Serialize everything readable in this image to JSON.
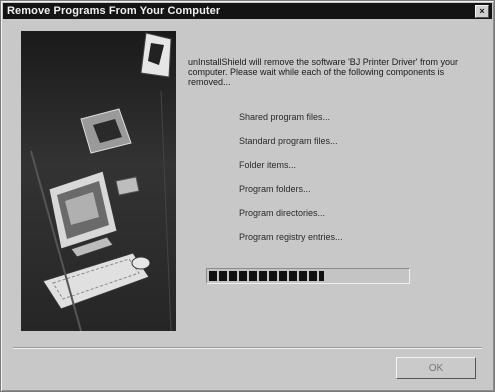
{
  "window": {
    "title": "Remove Programs From Your Computer",
    "close_glyph": "×"
  },
  "main": {
    "message": "unInstallShield will remove the software 'BJ Printer Driver' from your computer. Please wait while each of the following components is removed...",
    "steps": [
      "Shared program files...",
      "Standard program files...",
      "Folder items...",
      "Program folders...",
      "Program directories...",
      "Program registry entries..."
    ],
    "progress_fraction": 0.58
  },
  "footer": {
    "ok_label": "OK"
  },
  "colors": {
    "titlebar": "#141414",
    "dialog_background": "#c8c8c8",
    "progress_block": "#101010"
  },
  "icons": [
    "close-icon",
    "computer-illustration"
  ]
}
